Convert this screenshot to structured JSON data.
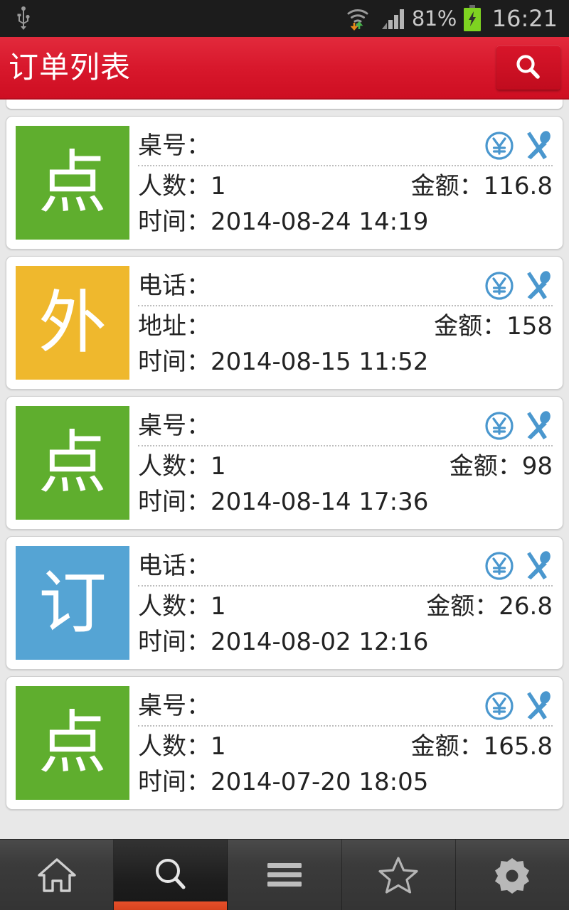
{
  "status_bar": {
    "usb_icon": "usb-icon",
    "wifi_icon": "wifi-icon",
    "data_transfer_icon": "data-transfer-arrows-icon",
    "signal_icon": "cellular-signal-icon",
    "battery_percent": "81%",
    "battery_icon": "battery-charging-icon",
    "time": "16:21"
  },
  "header": {
    "title": "订单列表",
    "search_icon": "search-icon"
  },
  "colors": {
    "header_red": "#d8182c",
    "badge_green": "#5fae2e",
    "badge_amber": "#efb82d",
    "badge_blue": "#55a4d4",
    "icon_blue": "#4a97ce",
    "active_tab_underline": "#d8441f",
    "page_background": "#e8e8e8"
  },
  "orders": [
    {
      "badge_text": "点",
      "badge_color": "#5fae2e",
      "badge_type": "dine-in",
      "row1_label": "桌号：",
      "row1_value": "",
      "row2_label": "人数：",
      "row2_value": "1",
      "amount_label": "金额：",
      "amount_value": "116.8",
      "time_label": "时间：",
      "time_value": "2014-08-24 14:19",
      "pay_icon": "yuan-circle-icon",
      "serve_icon": "cutlery-icon"
    },
    {
      "badge_text": "外",
      "badge_color": "#efb82d",
      "badge_type": "takeaway",
      "row1_label": "电话：",
      "row1_value": "",
      "row2_label": "地址：",
      "row2_value": "",
      "amount_label": "金额：",
      "amount_value": "158",
      "time_label": "时间：",
      "time_value": "2014-08-15 11:52",
      "pay_icon": "yuan-circle-icon",
      "serve_icon": "cutlery-icon"
    },
    {
      "badge_text": "点",
      "badge_color": "#5fae2e",
      "badge_type": "dine-in",
      "row1_label": "桌号：",
      "row1_value": "",
      "row2_label": "人数：",
      "row2_value": "1",
      "amount_label": "金额：",
      "amount_value": "98",
      "time_label": "时间：",
      "time_value": "2014-08-14 17:36",
      "pay_icon": "yuan-circle-icon",
      "serve_icon": "cutlery-icon"
    },
    {
      "badge_text": "订",
      "badge_color": "#55a4d4",
      "badge_type": "reservation",
      "row1_label": "电话：",
      "row1_value": "",
      "row2_label": "人数：",
      "row2_value": "1",
      "amount_label": "金额：",
      "amount_value": "26.8",
      "time_label": "时间：",
      "time_value": "2014-08-02 12:16",
      "pay_icon": "yuan-circle-icon",
      "serve_icon": "cutlery-icon"
    },
    {
      "badge_text": "点",
      "badge_color": "#5fae2e",
      "badge_type": "dine-in",
      "row1_label": "桌号：",
      "row1_value": "",
      "row2_label": "人数：",
      "row2_value": "1",
      "amount_label": "金额：",
      "amount_value": "165.8",
      "time_label": "时间：",
      "time_value": "2014-07-20 18:05",
      "pay_icon": "yuan-circle-icon",
      "serve_icon": "cutlery-icon"
    }
  ],
  "bottom_nav": {
    "active_index": 1,
    "items": [
      {
        "icon": "home-icon",
        "name": "nav-home"
      },
      {
        "icon": "search-icon",
        "name": "nav-search"
      },
      {
        "icon": "menu-icon",
        "name": "nav-menu"
      },
      {
        "icon": "star-icon",
        "name": "nav-favorites"
      },
      {
        "icon": "gear-icon",
        "name": "nav-settings"
      }
    ]
  }
}
